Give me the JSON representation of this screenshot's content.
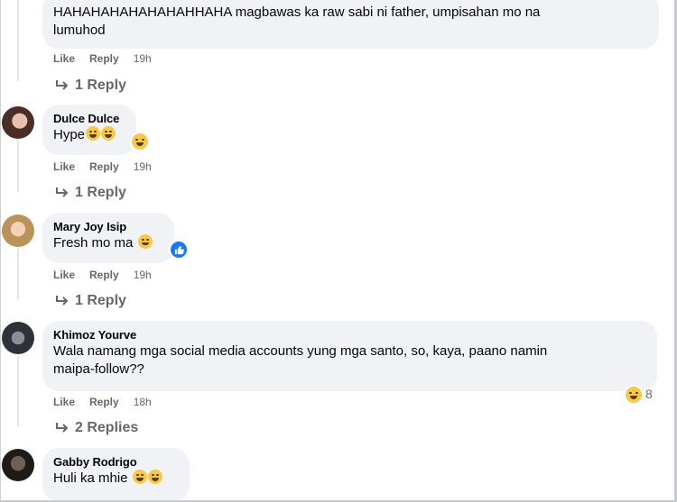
{
  "actions": {
    "like": "Like",
    "reply": "Reply"
  },
  "comments": [
    {
      "author": "",
      "text_lines": [
        "HAHAHAHAHAHAHAHHAHA magbawas ka raw sabi ni father, umpisahan mo na",
        "lumuhod"
      ],
      "time": "19h",
      "replies": "1 Reply"
    },
    {
      "author": "Dulce Dulce",
      "text": "Hype",
      "time": "19h",
      "replies": "1 Reply",
      "reaction": "haha-icon"
    },
    {
      "author": "Mary Joy Isip",
      "text": "Fresh mo ma",
      "time": "19h",
      "replies": "1 Reply",
      "reaction": "like-icon"
    },
    {
      "author": "Khimoz Yourve",
      "text_lines": [
        "Wala namang mga social media accounts yung mga santo, so, kaya, paano namin",
        "maipa-follow??"
      ],
      "time": "18h",
      "replies": "2 Replies",
      "reaction": "haha-icon",
      "reaction_count": "8"
    },
    {
      "author": "Gabby Rodrigo",
      "text": "Huli ka mhie"
    }
  ],
  "colors": {
    "bubble": "#f0f2f5",
    "meta": "#65676b",
    "text": "#050505",
    "like_blue": "#1877f2"
  }
}
